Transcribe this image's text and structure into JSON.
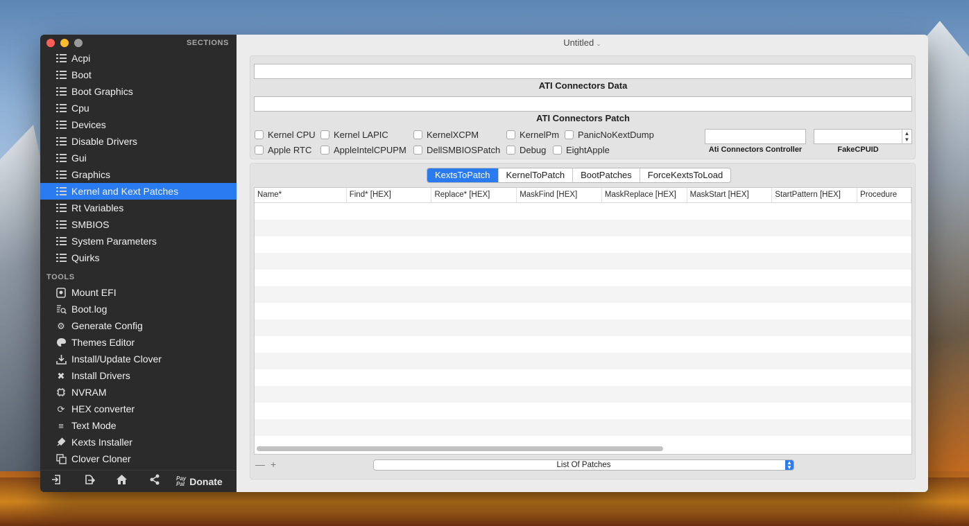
{
  "window": {
    "title": "Untitled"
  },
  "sidebar": {
    "sections_header": "SECTIONS",
    "sections": [
      {
        "label": "Acpi"
      },
      {
        "label": "Boot"
      },
      {
        "label": "Boot Graphics"
      },
      {
        "label": "Cpu"
      },
      {
        "label": "Devices"
      },
      {
        "label": "Disable Drivers"
      },
      {
        "label": "Gui"
      },
      {
        "label": "Graphics"
      },
      {
        "label": "Kernel and Kext Patches",
        "selected": true
      },
      {
        "label": "Rt Variables"
      },
      {
        "label": "SMBIOS"
      },
      {
        "label": "System Parameters"
      },
      {
        "label": "Quirks"
      }
    ],
    "tools_header": "TOOLS",
    "tools": [
      {
        "label": "Mount EFI",
        "icon": "disk-icon"
      },
      {
        "label": "Boot.log",
        "icon": "log-search-icon"
      },
      {
        "label": "Generate Config",
        "icon": "gears-icon"
      },
      {
        "label": "Themes Editor",
        "icon": "palette-icon"
      },
      {
        "label": "Install/Update Clover",
        "icon": "download-icon"
      },
      {
        "label": "Install Drivers",
        "icon": "tools-icon"
      },
      {
        "label": "NVRAM",
        "icon": "chip-icon"
      },
      {
        "label": "HEX converter",
        "icon": "refresh-icon"
      },
      {
        "label": "Text Mode",
        "icon": "text-icon"
      },
      {
        "label": "Kexts Installer",
        "icon": "plug-icon"
      },
      {
        "label": "Clover Cloner",
        "icon": "clone-icon"
      }
    ],
    "bottom": {
      "paypal_top": "Pay",
      "paypal_bottom": "Pal",
      "donate_label": "Donate"
    }
  },
  "ati": {
    "connectors_data_value": "",
    "connectors_data_label": "ATI Connectors Data",
    "connectors_patch_value": "",
    "connectors_patch_label": "ATI Connectors Patch",
    "controller_label": "Ati Connectors Controller",
    "controller_value": "",
    "fakecpuid_label": "FakeCPUID",
    "fakecpuid_value": ""
  },
  "checkboxes": {
    "kernel_cpu": "Kernel CPU",
    "kernel_lapic": "Kernel LAPIC",
    "kernel_xcpm": "KernelXCPM",
    "kernel_pm": "KernelPm",
    "panic_no_kext_dump": "PanicNoKextDump",
    "apple_rtc": "Apple RTC",
    "apple_intel_cpupm": "AppleIntelCPUPM",
    "dell_smbios_patch": "DellSMBIOSPatch",
    "debug": "Debug",
    "eight_apple": "EightApple"
  },
  "tabs": [
    "KextsToPatch",
    "KernelToPatch",
    "BootPatches",
    "ForceKextsToLoad"
  ],
  "selected_tab": "KextsToPatch",
  "table": {
    "columns": [
      "Name*",
      "Find* [HEX]",
      "Replace* [HEX]",
      "MaskFind [HEX]",
      "MaskReplace [HEX]",
      "MaskStart [HEX]",
      "StartPattern [HEX]",
      "Procedure"
    ],
    "rows": []
  },
  "footer": {
    "minus": "—",
    "plus": "+",
    "popup_label": "List Of Patches"
  }
}
